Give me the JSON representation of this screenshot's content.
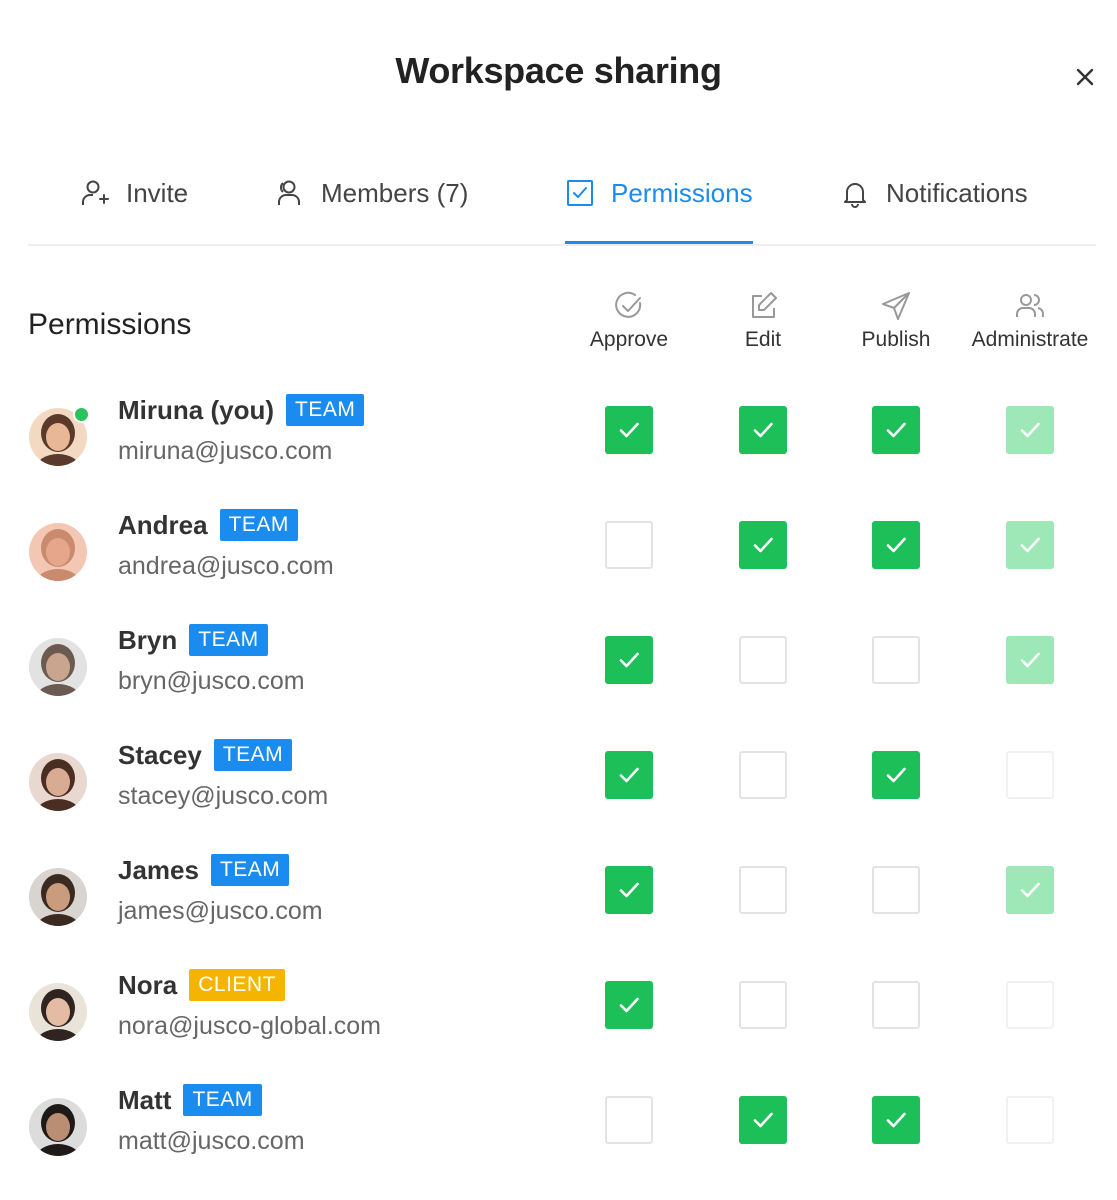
{
  "dialog": {
    "title": "Workspace sharing",
    "close_icon": "close-icon"
  },
  "tabs": [
    {
      "label": "Invite",
      "icon": "user-plus-icon",
      "active": false
    },
    {
      "label": "Members (7)",
      "icon": "users-icon",
      "active": false
    },
    {
      "label": "Permissions",
      "icon": "checkbox-icon",
      "active": true
    },
    {
      "label": "Notifications",
      "icon": "bell-icon",
      "active": false
    }
  ],
  "permissions": {
    "heading": "Permissions",
    "columns": [
      {
        "label": "Approve",
        "icon": "check-circle-icon"
      },
      {
        "label": "Edit",
        "icon": "edit-icon"
      },
      {
        "label": "Publish",
        "icon": "send-icon"
      },
      {
        "label": "Administrate",
        "icon": "users-icon"
      }
    ]
  },
  "colors": {
    "accent": "#1a8cf0",
    "checked": "#1dbf59",
    "checked_disabled": "#9de8b6",
    "team_badge": "#1a8cf0",
    "client_badge": "#f5b400",
    "online": "#2ac25a"
  },
  "members": [
    {
      "name": "Miruna (you)",
      "badge": "TEAM",
      "email": "miruna@jusco.com",
      "online": true,
      "perms": [
        "checked",
        "checked",
        "checked",
        "checked-light"
      ]
    },
    {
      "name": "Andrea",
      "badge": "TEAM",
      "email": "andrea@jusco.com",
      "online": false,
      "perms": [
        "unchecked",
        "checked",
        "checked",
        "checked-light"
      ]
    },
    {
      "name": "Bryn",
      "badge": "TEAM",
      "email": "bryn@jusco.com",
      "online": false,
      "perms": [
        "checked",
        "unchecked",
        "unchecked",
        "checked-light"
      ]
    },
    {
      "name": "Stacey",
      "badge": "TEAM",
      "email": "stacey@jusco.com",
      "online": false,
      "perms": [
        "checked",
        "unchecked",
        "checked",
        "unchecked-light"
      ]
    },
    {
      "name": "James",
      "badge": "TEAM",
      "email": "james@jusco.com",
      "online": false,
      "perms": [
        "checked",
        "unchecked",
        "unchecked",
        "checked-light"
      ]
    },
    {
      "name": "Nora",
      "badge": "CLIENT",
      "email": "nora@jusco-global.com",
      "online": false,
      "perms": [
        "checked",
        "unchecked",
        "unchecked",
        "unchecked-light"
      ]
    },
    {
      "name": "Matt",
      "badge": "TEAM",
      "email": "matt@jusco.com",
      "online": false,
      "perms": [
        "unchecked",
        "checked",
        "checked",
        "unchecked-light"
      ]
    }
  ]
}
